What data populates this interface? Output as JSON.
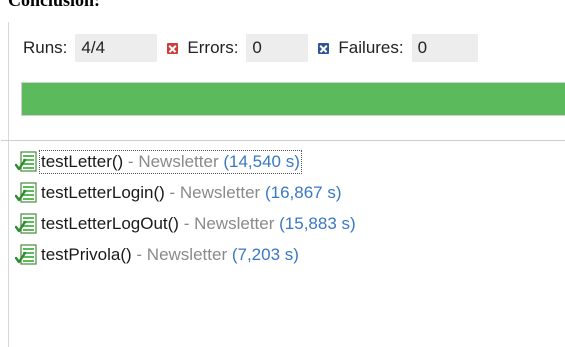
{
  "document": {
    "heading": "Conclusion:"
  },
  "counters": {
    "runs_label": "Runs:",
    "runs_value": "4/4",
    "errors_label": "Errors:",
    "errors_value": "0",
    "failures_label": "Failures:",
    "failures_value": "0"
  },
  "progress": {
    "fraction": 1.0,
    "color": "#5bba5b"
  },
  "tests": [
    {
      "name": "testLetter()",
      "separator": " - ",
      "class": "Newsletter",
      "time": "(14,540 s)",
      "selected": true
    },
    {
      "name": "testLetterLogin()",
      "separator": " - ",
      "class": "Newsletter",
      "time": "(16,867 s)",
      "selected": false
    },
    {
      "name": "testLetterLogOut()",
      "separator": " - ",
      "class": "Newsletter",
      "time": "(15,883 s)",
      "selected": false
    },
    {
      "name": "testPrivola()",
      "separator": " - ",
      "class": "Newsletter",
      "time": "(7,203 s)",
      "selected": false
    }
  ],
  "icons": {
    "error": "error-icon",
    "failure": "failure-icon",
    "test_passed": "test-passed-icon"
  },
  "colors": {
    "error": "#d33a3a",
    "failure": "#2f5597",
    "pass": "#5bba5b",
    "time": "#3a78c4"
  }
}
